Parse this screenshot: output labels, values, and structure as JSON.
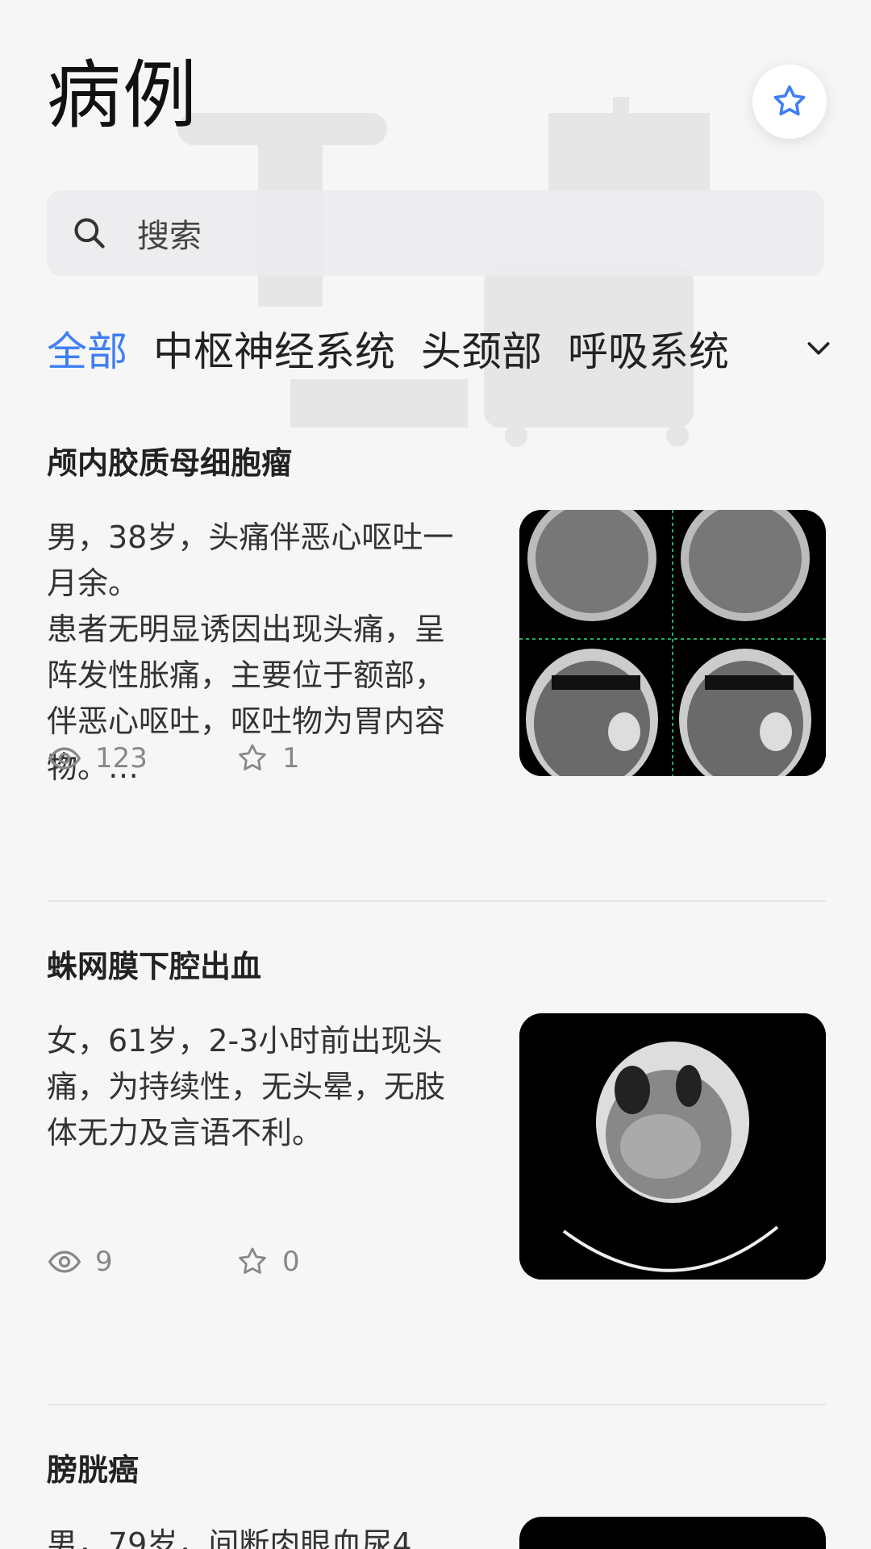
{
  "header": {
    "title": "病例"
  },
  "search": {
    "placeholder": "搜索"
  },
  "tabs": [
    {
      "label": "全部",
      "active": true
    },
    {
      "label": "中枢神经系统",
      "active": false
    },
    {
      "label": "头颈部",
      "active": false
    },
    {
      "label": "呼吸系统",
      "active": false
    }
  ],
  "colors": {
    "accent": "#3d7ef4",
    "text": "#1a1a1a",
    "muted": "#888888",
    "background": "#f6f6f7"
  },
  "cases": [
    {
      "title": "颅内胶质母细胞瘤",
      "summary": "男，38岁，头痛伴恶心呕吐一月余。",
      "detail": "患者无明显诱因出现头痛，呈阵发性胀痛，主要位于额部，伴恶心呕吐，呕吐物为胃内容物。…",
      "views": "123",
      "favorites": "1",
      "image_label": "CT brain slices (4-panel)"
    },
    {
      "title": "蛛网膜下腔出血",
      "summary": "女，61岁，2-3小时前出现头痛，为持续性，无头晕，无肢体无力及言语不利。",
      "detail": "",
      "views": "9",
      "favorites": "0",
      "image_label": "CT head axial slice"
    },
    {
      "title": "膀胱癌",
      "summary": "男，79岁，间断肉眼血尿4",
      "detail": "",
      "views": "",
      "favorites": "",
      "image_label": "CT image"
    }
  ]
}
